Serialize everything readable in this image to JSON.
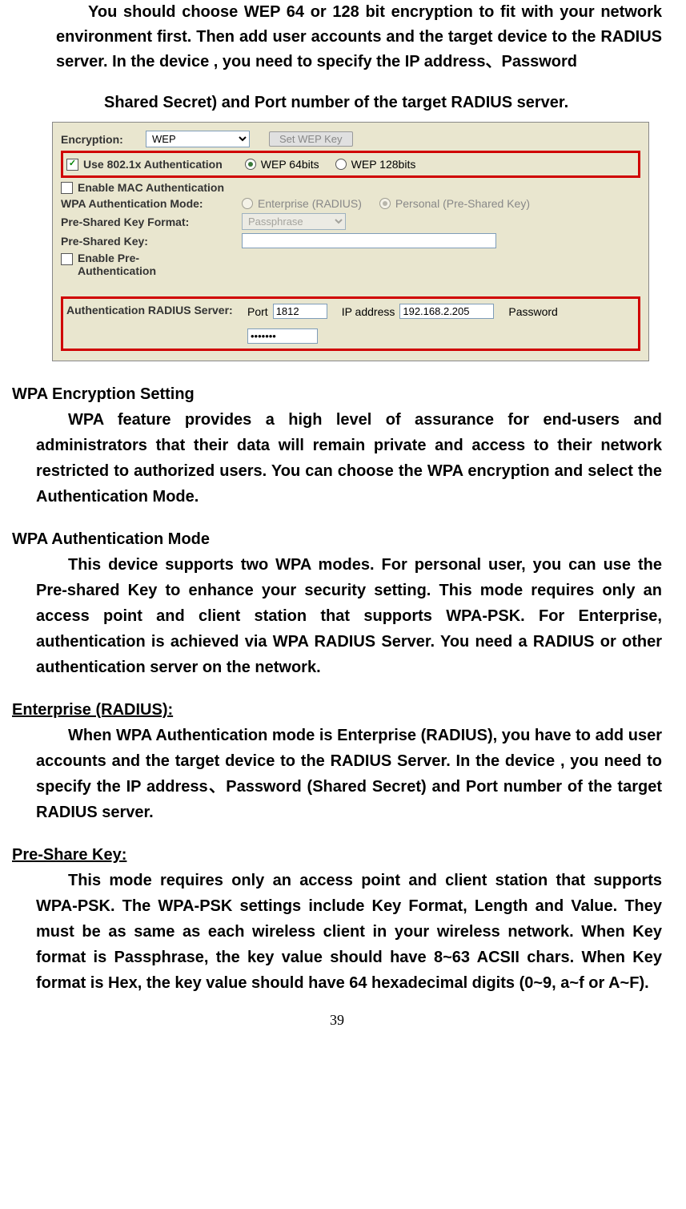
{
  "intro": {
    "p1": "You should choose WEP 64 or 128 bit encryption to fit with your network environment first. Then add user accounts and the target device to the RADIUS server. In the device , you need to specify the IP address、Password",
    "p2": "Shared Secret) and Port number of the target RADIUS server."
  },
  "screenshot": {
    "encryption_label": "Encryption:",
    "encryption_value": "WEP",
    "set_wep_key_btn": "Set WEP Key",
    "use_8021x_label": "Use 802.1x Authentication",
    "wep64_label": "WEP 64bits",
    "wep128_label": "WEP 128bits",
    "enable_mac_label": "Enable MAC Authentication",
    "wpa_auth_mode_label": "WPA Authentication Mode:",
    "enterprise_radius_label": "Enterprise (RADIUS)",
    "personal_psk_label": "Personal (Pre-Shared Key)",
    "psk_format_label": "Pre-Shared Key Format:",
    "psk_format_value": "Passphrase",
    "psk_label": "Pre-Shared Key:",
    "enable_preauth_label": "Enable Pre-Authentication",
    "auth_radius_server_label": "Authentication RADIUS Server:",
    "port_label": "Port",
    "port_value": "1812",
    "ip_label": "IP address",
    "ip_value": "192.168.2.205",
    "password_label": "Password",
    "password_value": "•••••••"
  },
  "sections": {
    "wpa_encryption": {
      "heading": "WPA Encryption Setting",
      "text": "WPA feature provides a high level of assurance for end-users and administrators that their data will remain private and access to their network restricted to authorized users. You can choose the WPA encryption and select the Authentication Mode."
    },
    "wpa_auth_mode": {
      "heading": "WPA Authentication Mode",
      "text": "This device supports two WPA modes. For personal user, you can use the Pre-shared Key to enhance your security setting. This mode requires only an access point and client station that supports WPA-PSK. For Enterprise, authentication is achieved via WPA RADIUS Server. You need a RADIUS or other authentication server on the network."
    },
    "enterprise": {
      "heading": "Enterprise (RADIUS):",
      "text": "When WPA Authentication mode is Enterprise (RADIUS), you have to add user accounts and the target device to the RADIUS Server. In the device , you need to specify the IP address、Password (Shared Secret) and Port number of the target RADIUS server."
    },
    "preshare": {
      "heading": "Pre-Share Key:",
      "text": "This mode requires only an access point and client station that supports WPA-PSK. The WPA-PSK settings include Key Format, Length and Value. They must be as same as each wireless client in your wireless network. When Key format is Passphrase, the key value should have 8~63 ACSII chars. When Key format is Hex, the key value should have 64 hexadecimal digits (0~9, a~f or A~F)."
    }
  },
  "page_number": "39"
}
